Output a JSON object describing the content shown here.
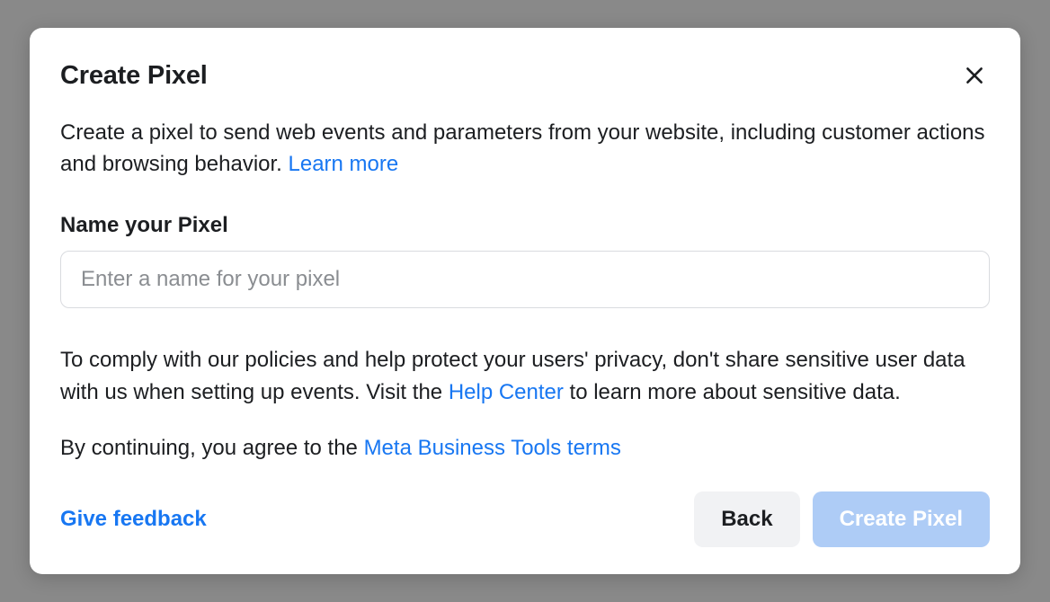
{
  "modal": {
    "title": "Create Pixel",
    "description_pre": "Create a pixel to send web events and parameters from your website, including customer actions and browsing behavior. ",
    "learn_more": "Learn more",
    "field_label": "Name your Pixel",
    "input_placeholder": "Enter a name for your pixel",
    "input_value": "",
    "policy_pre": "To comply with our policies and help protect your users' privacy, don't share sensitive user data with us when setting up events. Visit the ",
    "help_center": "Help Center",
    "policy_post": " to learn more about sensitive data.",
    "terms_pre": "By continuing, you agree to the ",
    "terms_link": "Meta Business Tools terms"
  },
  "footer": {
    "feedback": "Give feedback",
    "back": "Back",
    "create": "Create Pixel"
  }
}
